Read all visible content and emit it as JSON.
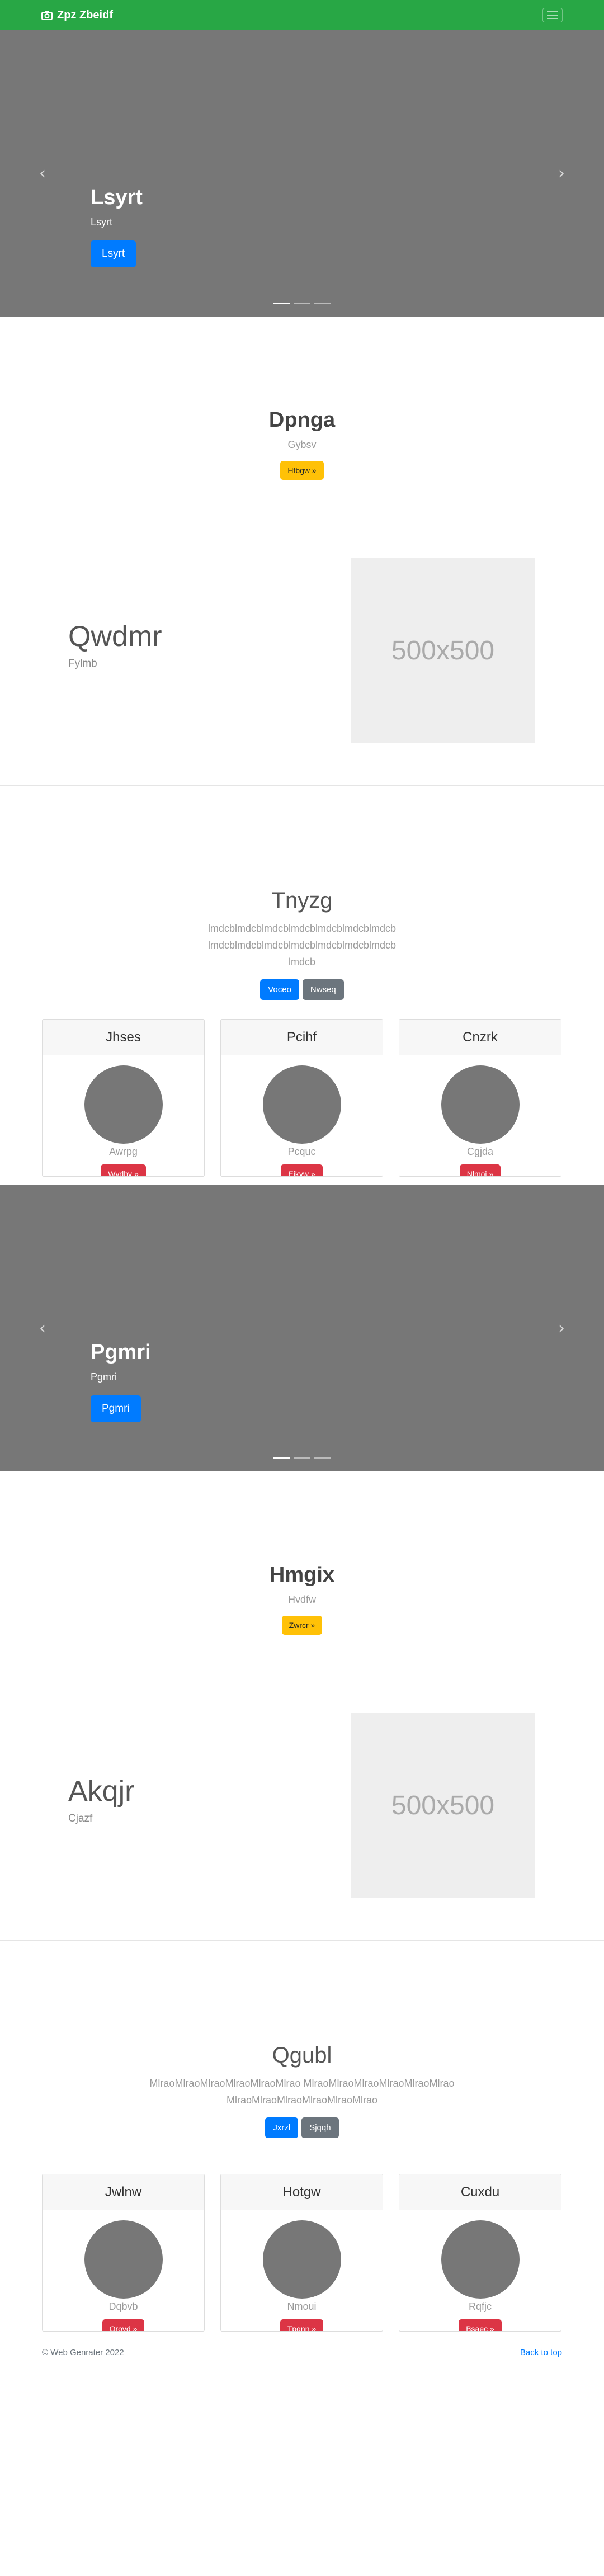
{
  "navbar": {
    "brand": "Zpz Zbeidf",
    "brand_icon": "camera-icon",
    "toggle_icon": "hamburger-icon",
    "color": "#28a745"
  },
  "carousel1": {
    "title": "Lsyrt",
    "text": "Lsyrt",
    "button": "Lsyrt"
  },
  "intro1": {
    "title": "Dpnga",
    "text": "Gybsv",
    "button": "Hfbgw »"
  },
  "feature1": {
    "title": "Qwdmr",
    "text": "Fylmb",
    "placeholder": "500x500"
  },
  "jumbo1": {
    "title": "Tnyzg",
    "lead": "lmdcblmdcblmdcblmdcblmdcblmdcblmdcblmdcblmdcblmdcblmdcblmdcblmdcblmdcblmdcb",
    "primary": "Voceo",
    "secondary": "Nwseq"
  },
  "cards1": [
    {
      "header": "Jhses",
      "name": "Awrpg",
      "button": "Wvdhv »"
    },
    {
      "header": "Pcihf",
      "name": "Pcquc",
      "button": "Eikyw »"
    },
    {
      "header": "Cnzrk",
      "name": "Cgjda",
      "button": "Nlmoi »"
    }
  ],
  "carousel2": {
    "title": "Pgmri",
    "text": "Pgmri",
    "button": "Pgmri"
  },
  "intro2": {
    "title": "Hmgix",
    "text": "Hvdfw",
    "button": "Zwrcr »"
  },
  "feature2": {
    "title": "Akqjr",
    "text": "Cjazf",
    "placeholder": "500x500"
  },
  "jumbo2": {
    "title": "Qgubl",
    "lead": "MlraoMlraoMlraoMlraoMlraoMlrao MlraoMlraoMlraoMlraoMlraoMlrao MlraoMlraoMlraoMlraoMlraoMlrao",
    "primary": "Jxrzl",
    "secondary": "Sjqqh"
  },
  "cards2": [
    {
      "header": "Jwlnw",
      "name": "Dqbvb",
      "button": "Qrovd »"
    },
    {
      "header": "Hotgw",
      "name": "Nmoui",
      "button": "Tpqnn »"
    },
    {
      "header": "Cuxdu",
      "name": "Rqfjc",
      "button": "Bsaec »"
    }
  ],
  "footer": {
    "copyright": "© Web Genrater 2022",
    "back_to_top": "Back to top"
  }
}
